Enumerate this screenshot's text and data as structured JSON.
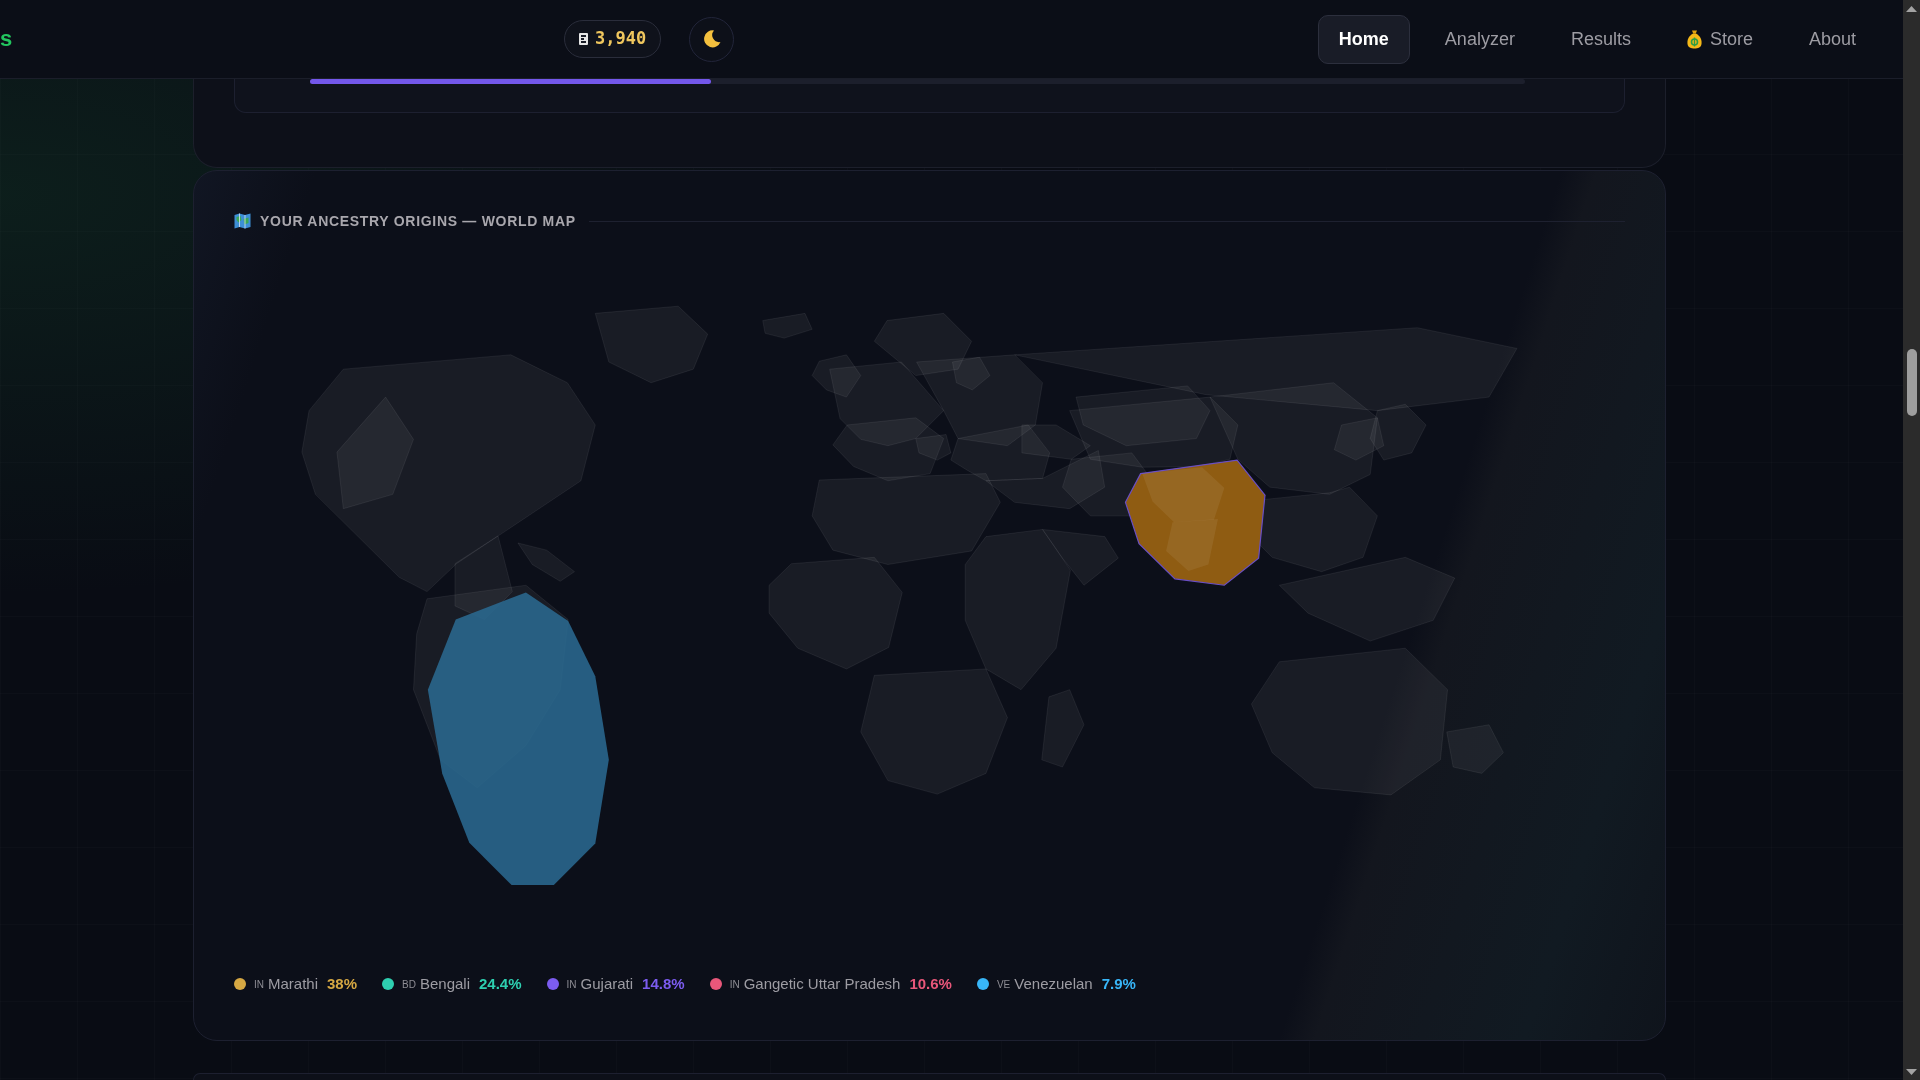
{
  "header": {
    "logo_text": "s",
    "coins": {
      "amount": "3,940"
    },
    "nav": [
      {
        "label": "Home",
        "selected": true,
        "kind": "link"
      },
      {
        "label": "Analyzer",
        "selected": false,
        "kind": "link"
      },
      {
        "label": "Results",
        "selected": false,
        "kind": "link"
      },
      {
        "label": "Store",
        "selected": false,
        "kind": "store"
      },
      {
        "label": "About",
        "selected": false,
        "kind": "link"
      }
    ]
  },
  "previous_section": {
    "progress": {
      "level": 0.33
    }
  },
  "map_card": {
    "title": "YOUR ANCESTRY ORIGINS — WORLD MAP",
    "legend": [
      {
        "code": "IN",
        "name": "Marathi",
        "percent": "38%",
        "color": "#d6a843"
      },
      {
        "code": "BD",
        "name": "Bengali",
        "percent": "24.4%",
        "color": "#2ecfb0"
      },
      {
        "code": "IN",
        "name": "Gujarati",
        "percent": "14.8%",
        "color": "#7c5cf0"
      },
      {
        "code": "IN",
        "name": "Gangetic Uttar Pradesh",
        "percent": "10.6%",
        "color": "#e8577a"
      },
      {
        "code": "VE",
        "name": "Venezuelan",
        "percent": "7.9%",
        "color": "#38b6f8"
      }
    ]
  }
}
